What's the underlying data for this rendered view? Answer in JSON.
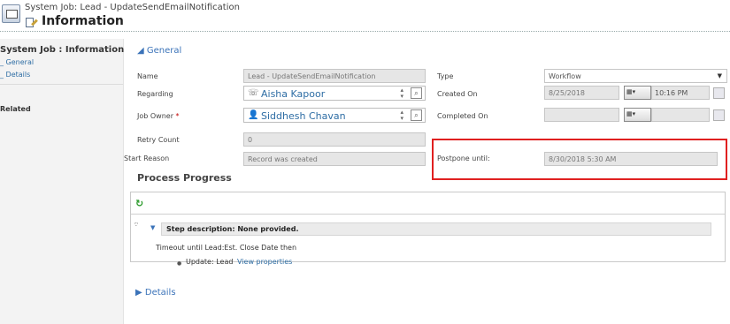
{
  "header": {
    "subtitle": "System Job: Lead - UpdateSendEmailNotification",
    "title": "Information"
  },
  "leftnav": {
    "heading": "System Job : Information",
    "links": [
      "_ General",
      "_ Details"
    ],
    "related": "Related"
  },
  "general": {
    "section_label": "◢ General",
    "name_label": "Name",
    "name_value": "Lead - UpdateSendEmailNotification",
    "regarding_label": "Regarding",
    "regarding_value": "Aisha Kapoor",
    "job_owner_label": "Job Owner",
    "required_marker": "*",
    "job_owner_value": "Siddhesh Chavan",
    "retry_count_label": "Retry Count",
    "retry_count_value": "0",
    "start_reason_label": "Start Reason",
    "start_reason_value": "Record was created",
    "type_label": "Type",
    "type_value": "Workflow",
    "created_on_label": "Created On",
    "created_on_date": "8/25/2018",
    "created_on_time": "10:16 PM",
    "completed_on_label": "Completed On",
    "completed_on_date": "",
    "completed_on_time": "",
    "postpone_label": "Postpone until:",
    "postpone_value": "8/30/2018 5:30 AM"
  },
  "process_progress": {
    "heading": "Process Progress",
    "step_description": "Step description: None provided.",
    "timeout_text": "Timeout until Lead:Est. Close Date then",
    "update_text": "Update:  Lead",
    "view_properties": "View properties"
  },
  "details": {
    "section_label": "▶ Details"
  },
  "colors": {
    "link": "#2e6da4",
    "section_accent": "#3b73b9",
    "highlight_border": "#e02020",
    "refresh_icon": "#2b9a2b"
  },
  "icons": {
    "header": "system-job-icon",
    "title": "information-edit-icon",
    "regarding": "lead-contact-icon",
    "owner": "user-icon",
    "lookup": "lookup-icon",
    "calendar": "calendar-icon",
    "refresh": "refresh-icon"
  }
}
